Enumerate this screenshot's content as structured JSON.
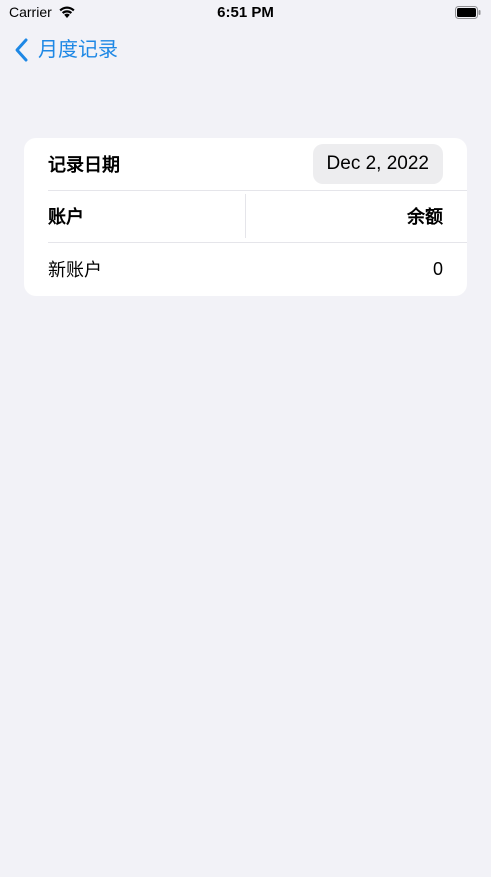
{
  "status_bar": {
    "carrier": "Carrier",
    "time": "6:51 PM",
    "icons": [
      "wifi-icon",
      "battery-icon"
    ]
  },
  "nav": {
    "back_label": "月度记录",
    "back_icon": "chevron-left-icon",
    "accent_color": "#1E88E5"
  },
  "record": {
    "date_label": "记录日期",
    "date_value": "Dec 2, 2022",
    "table": {
      "headers": [
        "账户",
        "余额"
      ],
      "rows": [
        {
          "account": "新账户",
          "balance": "0"
        }
      ]
    }
  }
}
